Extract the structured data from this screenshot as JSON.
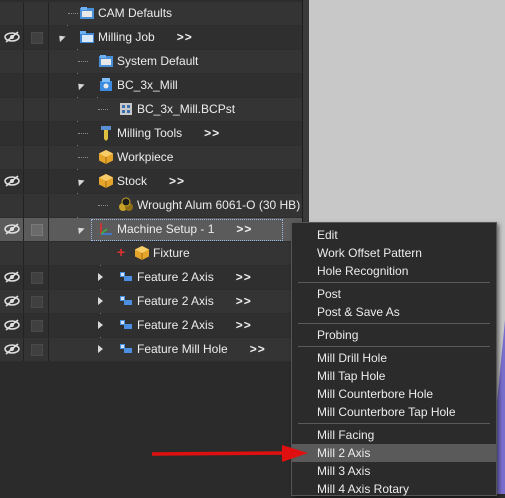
{
  "tree": {
    "rows": [
      {
        "label": "CAM Defaults",
        "more": ""
      },
      {
        "label": "Milling Job",
        "more": ">>"
      },
      {
        "label": "System Default",
        "more": ""
      },
      {
        "label": "BC_3x_Mill",
        "more": ""
      },
      {
        "label": "BC_3x_Mill.BCPst",
        "more": ""
      },
      {
        "label": "Milling Tools",
        "more": ">>"
      },
      {
        "label": "Workpiece",
        "more": ""
      },
      {
        "label": "Stock",
        "more": ">>"
      },
      {
        "label": "Wrought Alum 6061-O (30 HB)",
        "more": ""
      },
      {
        "label": "Machine Setup - 1",
        "more": ">>"
      },
      {
        "label": "Fixture",
        "more": ""
      },
      {
        "label": "Feature 2 Axis",
        "more": ">>"
      },
      {
        "label": "Feature 2 Axis",
        "more": ">>"
      },
      {
        "label": "Feature 2 Axis",
        "more": ">>"
      },
      {
        "label": "Feature Mill Hole",
        "more": ">>"
      }
    ]
  },
  "menu": {
    "items": [
      "Edit",
      "Work Offset Pattern",
      "Hole Recognition",
      "Post",
      "Post & Save As",
      "Probing",
      "Mill Drill Hole",
      "Mill Tap Hole",
      "Mill Counterbore Hole",
      "Mill Counterbore Tap Hole",
      "Mill Facing",
      "Mill 2 Axis",
      "Mill 3 Axis",
      "Mill 4 Axis Rotary"
    ],
    "highlighted": "Mill 2 Axis"
  },
  "colors": {
    "highlight": "#5a5a5a",
    "annotation_arrow": "#e01010"
  }
}
